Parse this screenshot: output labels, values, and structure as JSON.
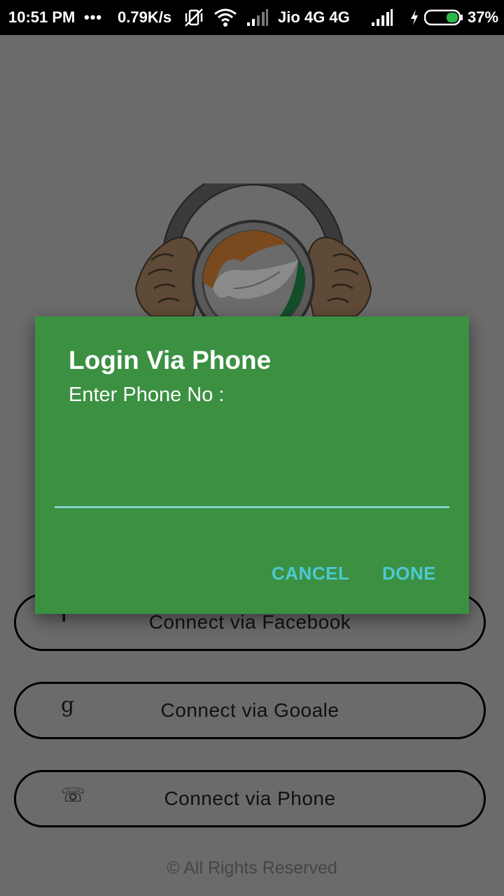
{
  "status_bar": {
    "time": "10:51 PM",
    "dots": "•••",
    "net_speed": "0.79K/s",
    "carrier": "Jio 4G 4G",
    "battery": "37%",
    "icons": [
      "vibrate-off-icon",
      "wifi-icon",
      "signal-icon",
      "signal-icon",
      "charging-icon",
      "battery-icon"
    ],
    "battery_color": "#2db84a"
  },
  "background": {
    "overlay_color": "#6b6b6b",
    "buttons": [
      {
        "icon_glyph": "f",
        "icon": "facebook-icon",
        "label": "Connect via Facebook"
      },
      {
        "icon_glyph": "g",
        "icon": "google-icon",
        "label": "Connect via Gooale"
      },
      {
        "icon_glyph": "☏",
        "icon": "phone-icon",
        "label": "Connect via Phone"
      }
    ],
    "footer": "© All Rights Reserved"
  },
  "dialog": {
    "title": "Login Via Phone",
    "message": "Enter Phone No :",
    "input_value": "",
    "cancel_label": "CANCEL",
    "done_label": "DONE",
    "background_color": "#3b9042",
    "accent_color": "#4ec9d2"
  }
}
